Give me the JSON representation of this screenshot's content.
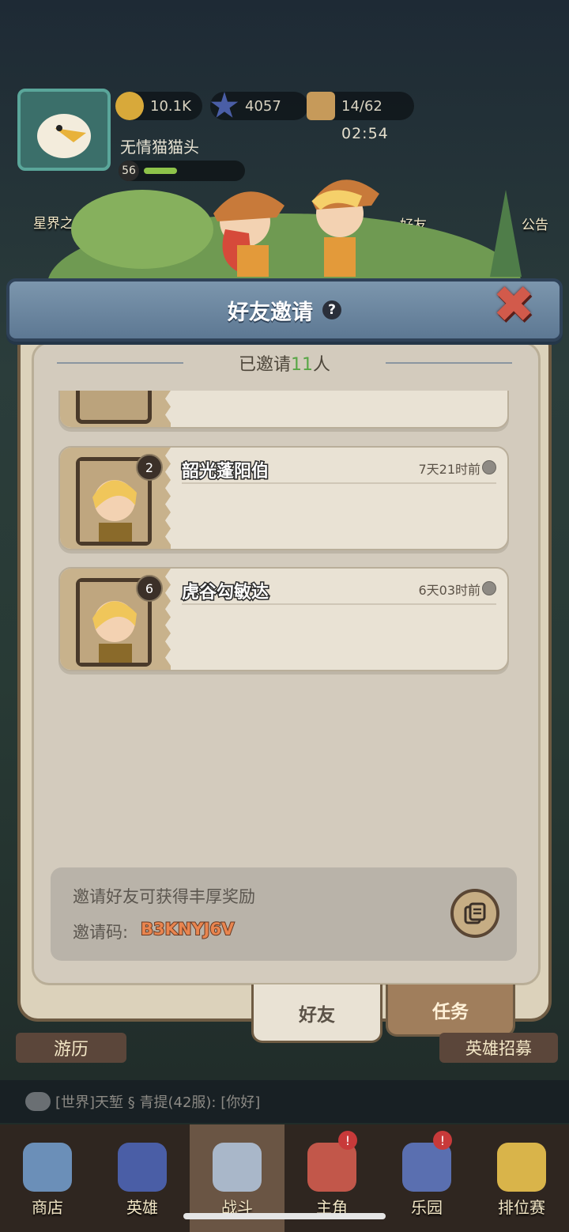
{
  "hud": {
    "coins": "10.1K",
    "stars": "4057",
    "tickets": "14/62",
    "timer": "02:54",
    "player_name": "无情猫猫头",
    "level": "56",
    "level_progress": 0.35,
    "left_label": "星界之主I",
    "friends_label": "好友",
    "notice_label": "公告"
  },
  "modal": {
    "title": "好友邀请",
    "help": "?",
    "close": "✖",
    "invited_prefix": "已邀请",
    "invited_count": "11",
    "invited_suffix": "人",
    "friends": [
      {
        "name": "",
        "level": "",
        "time": ""
      },
      {
        "name": "韶光蓬阳伯",
        "level": "2",
        "time": "7天21时前"
      },
      {
        "name": "虎谷勾敏达",
        "level": "6",
        "time": "6天03时前"
      }
    ],
    "invite_hint": "邀请好友可获得丰厚奖励",
    "invite_code_label": "邀请码:",
    "invite_code": "B3KNYJ6V",
    "tabs": {
      "friends": "好友",
      "tasks": "任务"
    }
  },
  "background": {
    "youli": "游历",
    "recruit": "英雄招募",
    "chat": "[世界]天堑 § 青提(42服): [你好]"
  },
  "nav": [
    {
      "label": "商店"
    },
    {
      "label": "英雄"
    },
    {
      "label": "战斗"
    },
    {
      "label": "主角"
    },
    {
      "label": "乐园"
    },
    {
      "label": "排位赛"
    }
  ],
  "colors": {
    "accent_green": "#58a646",
    "code_orange": "#e9854f",
    "banner_blue": "#6e89a2"
  }
}
